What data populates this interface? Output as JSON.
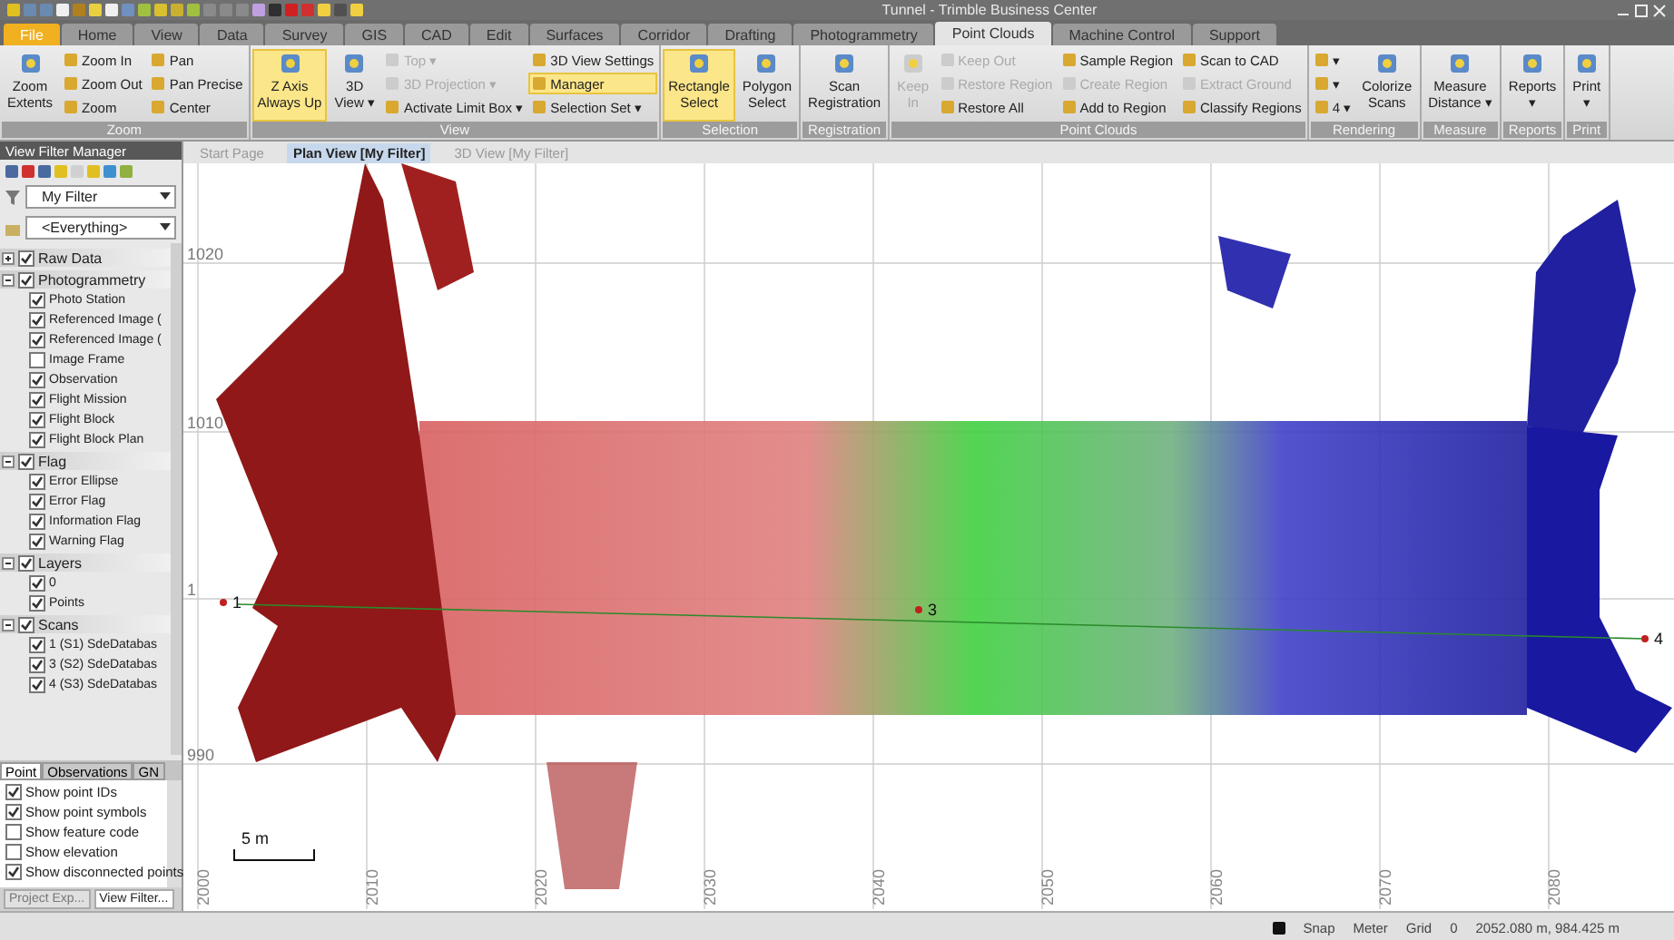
{
  "window": {
    "title": "Tunnel - Trimble Business Center"
  },
  "menu_tabs": [
    {
      "label": "File",
      "selected": false,
      "kind": "file"
    },
    {
      "label": "Home",
      "selected": false
    },
    {
      "label": "View",
      "selected": false
    },
    {
      "label": "Data",
      "selected": false
    },
    {
      "label": "Survey",
      "selected": false
    },
    {
      "label": "GIS",
      "selected": false
    },
    {
      "label": "CAD",
      "selected": false
    },
    {
      "label": "Edit",
      "selected": false
    },
    {
      "label": "Surfaces",
      "selected": false
    },
    {
      "label": "Corridor",
      "selected": false
    },
    {
      "label": "Drafting",
      "selected": false
    },
    {
      "label": "Photogrammetry",
      "selected": false
    },
    {
      "label": "Point Clouds",
      "selected": true
    },
    {
      "label": "Machine Control",
      "selected": false
    },
    {
      "label": "Support",
      "selected": false
    }
  ],
  "ribbon": [
    {
      "title": "Zoom",
      "items": [
        {
          "kind": "large",
          "lines": [
            "Zoom",
            "Extents"
          ],
          "disabled": false,
          "highlighted": false
        },
        {
          "kind": "column",
          "items": [
            {
              "label": "Zoom In",
              "disabled": false,
              "highlighted": false
            },
            {
              "label": "Zoom Out",
              "disabled": false,
              "highlighted": false
            },
            {
              "label": "Zoom",
              "disabled": false,
              "highlighted": false
            }
          ]
        },
        {
          "kind": "column",
          "items": [
            {
              "label": "Pan",
              "disabled": false,
              "highlighted": false
            },
            {
              "label": "Pan Precise",
              "disabled": false,
              "highlighted": false
            },
            {
              "label": "Center",
              "disabled": false,
              "highlighted": false
            }
          ]
        }
      ]
    },
    {
      "title": "View",
      "items": [
        {
          "kind": "large",
          "lines": [
            "Z Axis",
            "Always Up"
          ],
          "disabled": false,
          "highlighted": true
        },
        {
          "kind": "large",
          "lines": [
            "3D",
            "View ▾"
          ],
          "disabled": false,
          "highlighted": false
        },
        {
          "kind": "column",
          "items": [
            {
              "label": "Top ▾",
              "disabled": true,
              "highlighted": false
            },
            {
              "label": "3D Projection ▾",
              "disabled": true,
              "highlighted": false
            },
            {
              "label": "Activate Limit Box ▾",
              "disabled": false,
              "highlighted": false
            }
          ]
        },
        {
          "kind": "column",
          "items": [
            {
              "label": "3D View Settings",
              "disabled": false,
              "highlighted": false
            },
            {
              "label": "Manager",
              "disabled": false,
              "highlighted": true
            },
            {
              "label": "Selection Set ▾",
              "disabled": false,
              "highlighted": false
            }
          ]
        }
      ]
    },
    {
      "title": "Selection",
      "items": [
        {
          "kind": "large",
          "lines": [
            "Rectangle",
            "Select"
          ],
          "disabled": false,
          "highlighted": true
        },
        {
          "kind": "large",
          "lines": [
            "Polygon",
            "Select"
          ],
          "disabled": false,
          "highlighted": false
        }
      ]
    },
    {
      "title": "Registration",
      "items": [
        {
          "kind": "large",
          "lines": [
            "Scan",
            "Registration"
          ],
          "disabled": false,
          "highlighted": false
        }
      ]
    },
    {
      "title": "Point Clouds",
      "items": [
        {
          "kind": "large",
          "lines": [
            "Keep",
            "In"
          ],
          "disabled": true,
          "highlighted": false
        },
        {
          "kind": "column",
          "items": [
            {
              "label": "Keep Out",
              "disabled": true,
              "highlighted": false
            },
            {
              "label": "Restore Region",
              "disabled": true,
              "highlighted": false
            },
            {
              "label": "Restore All",
              "disabled": false,
              "highlighted": false
            }
          ]
        },
        {
          "kind": "column",
          "items": [
            {
              "label": "Sample Region",
              "disabled": false,
              "highlighted": false
            },
            {
              "label": "Create Region",
              "disabled": true,
              "highlighted": false
            },
            {
              "label": "Add to Region",
              "disabled": false,
              "highlighted": false
            }
          ]
        },
        {
          "kind": "column",
          "items": [
            {
              "label": "Scan to CAD",
              "disabled": false,
              "highlighted": false
            },
            {
              "label": "Extract Ground",
              "disabled": true,
              "highlighted": false
            },
            {
              "label": "Classify Regions",
              "disabled": false,
              "highlighted": false
            }
          ]
        }
      ]
    },
    {
      "title": "Rendering",
      "items": [
        {
          "kind": "column",
          "items": [
            {
              "label": "▾",
              "disabled": false,
              "highlighted": false
            },
            {
              "label": "▾",
              "disabled": false,
              "highlighted": false
            },
            {
              "label": "4 ▾",
              "disabled": false,
              "highlighted": false
            }
          ]
        },
        {
          "kind": "large",
          "lines": [
            "Colorize",
            "Scans"
          ],
          "disabled": false,
          "highlighted": false
        }
      ]
    },
    {
      "title": "Measure",
      "items": [
        {
          "kind": "large",
          "lines": [
            "Measure",
            "Distance ▾"
          ],
          "disabled": false,
          "highlighted": false
        }
      ]
    },
    {
      "title": "Reports",
      "items": [
        {
          "kind": "large",
          "lines": [
            "Reports",
            "▾"
          ],
          "disabled": false,
          "highlighted": false
        }
      ]
    },
    {
      "title": "Print",
      "items": [
        {
          "kind": "large",
          "lines": [
            "Print",
            "▾"
          ],
          "disabled": false,
          "highlighted": false
        }
      ]
    }
  ],
  "filter_panel": {
    "title": "View Filter Manager",
    "filter": "My Filter",
    "scope": "<Everything>",
    "tree": [
      {
        "label": "Raw Data",
        "checked": true,
        "expanded": false
      },
      {
        "label": "Photogrammetry",
        "checked": true,
        "expanded": true,
        "children": [
          {
            "label": "Photo Station",
            "checked": true
          },
          {
            "label": "Referenced Image (",
            "checked": true
          },
          {
            "label": "Referenced Image (",
            "checked": true
          },
          {
            "label": "Image Frame",
            "checked": false
          },
          {
            "label": "Observation",
            "checked": true
          },
          {
            "label": "Flight Mission",
            "checked": true
          },
          {
            "label": "Flight Block",
            "checked": true
          },
          {
            "label": "Flight Block Plan",
            "checked": true
          }
        ]
      },
      {
        "label": "Flag",
        "checked": true,
        "expanded": true,
        "children": [
          {
            "label": "Error Ellipse",
            "checked": true
          },
          {
            "label": "Error Flag",
            "checked": true
          },
          {
            "label": "Information Flag",
            "checked": true
          },
          {
            "label": "Warning Flag",
            "checked": true
          }
        ]
      },
      {
        "label": "Layers",
        "checked": true,
        "expanded": true,
        "children": [
          {
            "label": "0",
            "checked": true
          },
          {
            "label": "Points",
            "checked": true
          }
        ]
      },
      {
        "label": "Scans",
        "checked": true,
        "expanded": true,
        "children": [
          {
            "label": "1 (S1) SdeDatabas",
            "checked": true
          },
          {
            "label": "3 (S2) SdeDatabas",
            "checked": true
          },
          {
            "label": "4 (S3) SdeDatabas",
            "checked": true
          }
        ]
      }
    ],
    "option_tabs": [
      {
        "label": "Point",
        "selected": true
      },
      {
        "label": "Observations",
        "selected": false
      },
      {
        "label": "GN",
        "selected": false
      }
    ],
    "options": [
      {
        "label": "Show point IDs",
        "checked": true
      },
      {
        "label": "Show point symbols",
        "checked": true
      },
      {
        "label": "Show feature code",
        "checked": false
      },
      {
        "label": "Show elevation",
        "checked": false
      },
      {
        "label": "Show disconnected points",
        "checked": true
      }
    ],
    "footer_tabs": [
      {
        "label": "Project Exp...",
        "selected": false
      },
      {
        "label": "View Filter...",
        "selected": true
      }
    ]
  },
  "doc_tabs": [
    {
      "label": "Start Page",
      "selected": false
    },
    {
      "label": "Plan View [My Filter]",
      "selected": true
    },
    {
      "label": "3D View [My Filter]",
      "selected": false
    }
  ],
  "plan_view": {
    "y_labels": [
      "1020",
      "1010",
      "1",
      "990"
    ],
    "x_labels": [
      "2000",
      "2010",
      "2020",
      "2030",
      "2040",
      "2050",
      "2060",
      "2070",
      "2080"
    ],
    "points": [
      {
        "label": "1"
      },
      {
        "label": "3"
      },
      {
        "label": "4"
      }
    ],
    "scale": "5 m"
  },
  "status_bar": {
    "items": [
      "Snap",
      "Meter",
      "Grid",
      "0",
      "2052.080 m, 984.425 m"
    ]
  }
}
